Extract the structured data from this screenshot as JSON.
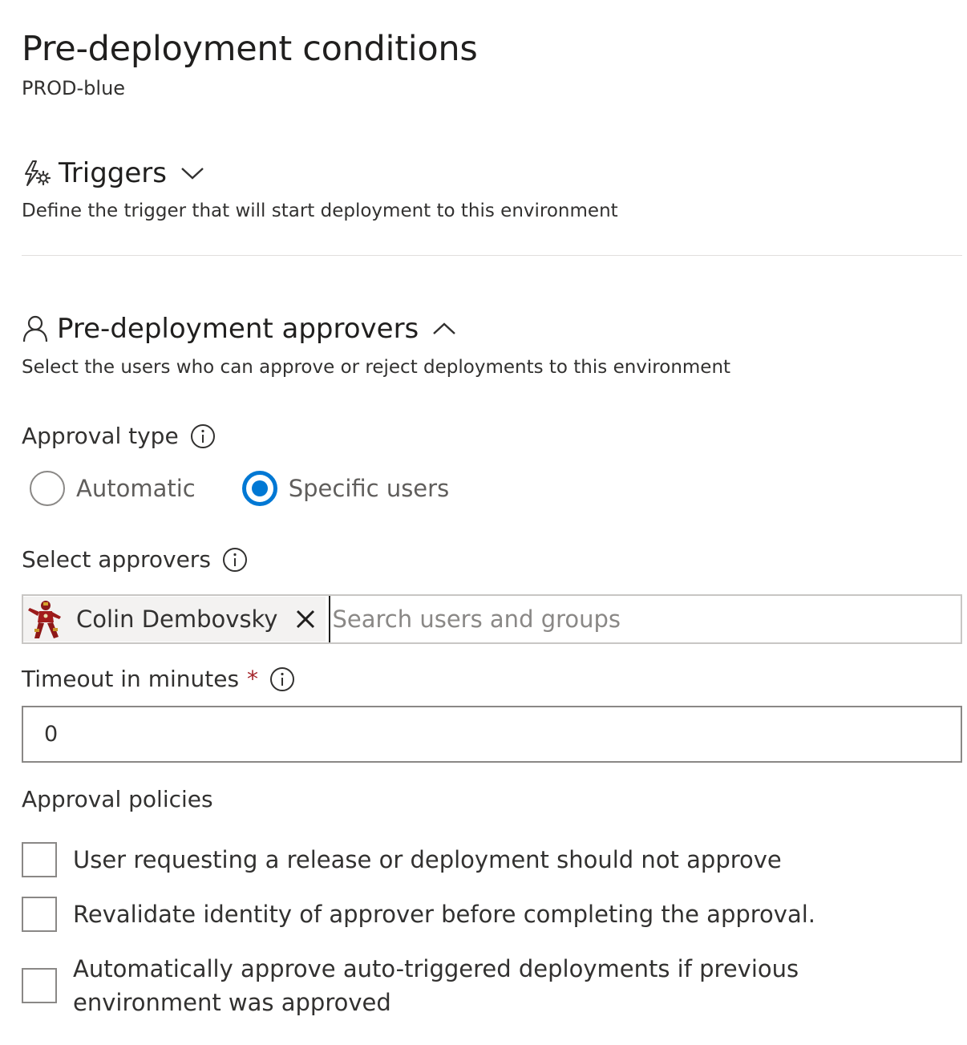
{
  "header": {
    "title": "Pre-deployment conditions",
    "subtitle": "PROD-blue"
  },
  "triggers": {
    "icon": "lightning-gear-icon",
    "label": "Triggers",
    "chevron": "chevron-down-icon",
    "description": "Define the trigger that will start deployment to this environment"
  },
  "approvers_section": {
    "icon": "person-icon",
    "label": "Pre-deployment approvers",
    "chevron": "chevron-up-icon",
    "description": "Select the users who can approve or reject deployments to this environment"
  },
  "approval_type": {
    "label": "Approval type",
    "options": [
      {
        "label": "Automatic",
        "selected": false
      },
      {
        "label": "Specific users",
        "selected": true
      }
    ]
  },
  "select_approvers": {
    "label": "Select approvers",
    "selected": [
      {
        "name": "Colin Dembovsky",
        "avatar": "iron-man-avatar"
      }
    ],
    "placeholder": "Search users and groups",
    "value": ""
  },
  "timeout": {
    "label": "Timeout in minutes",
    "required_mark": "*",
    "value": "0"
  },
  "approval_policies": {
    "label": "Approval policies",
    "items": [
      {
        "label": "User requesting a release or deployment should not approve",
        "checked": false
      },
      {
        "label": "Revalidate identity of approver before completing the approval.",
        "checked": false
      },
      {
        "label": "Automatically approve auto-triggered deployments if previous environment was approved",
        "checked": false
      }
    ]
  },
  "colors": {
    "accent": "#0078d4",
    "required": "#a4262c",
    "text": "#323130",
    "border": "#8a8886"
  }
}
